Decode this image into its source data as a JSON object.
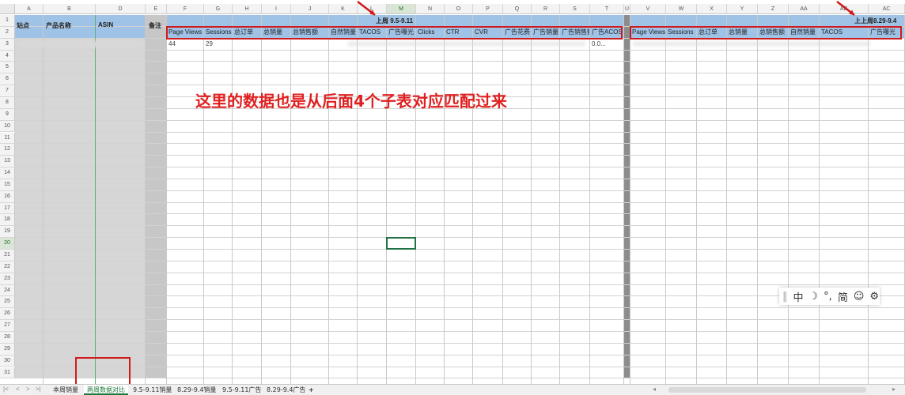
{
  "columns": [
    "A",
    "B",
    "D",
    "E",
    "F",
    "G",
    "H",
    "I",
    "J",
    "K",
    "L",
    "M",
    "N",
    "O",
    "P",
    "Q",
    "R",
    "S",
    "T",
    "U",
    "V",
    "W",
    "X",
    "Y",
    "Z",
    "AA",
    "AB",
    "AC"
  ],
  "rows": [
    "1",
    "2",
    "3",
    "4",
    "5",
    "6",
    "7",
    "8",
    "9",
    "10",
    "11",
    "12",
    "13",
    "14",
    "15",
    "16",
    "17",
    "18",
    "19",
    "20",
    "21",
    "22",
    "23",
    "24",
    "25",
    "26",
    "27",
    "28",
    "29",
    "30",
    "31"
  ],
  "left_headers": {
    "site": "站点",
    "product": "产品名称",
    "asin": "ASIN",
    "note": "备注"
  },
  "week1": {
    "title": "上周 9.5-9.11",
    "headers": [
      "Page Views",
      "Sessions",
      "总订单",
      "总销量",
      "总销售额",
      "自然销量",
      "TACOS",
      "广告曝光",
      "Clicks",
      "CTR",
      "CVR",
      "广告花费",
      "广告销量",
      "广告销售额",
      "广告ACOS"
    ],
    "row3": [
      "44",
      "29",
      "",
      "",
      "",
      "",
      "",
      "",
      "",
      "",
      "",
      "",
      "",
      "",
      "0.0..."
    ]
  },
  "week2": {
    "title": "上上周8.29-9.4",
    "headers": [
      "Page Views",
      "Sessions",
      "总订单",
      "总销量",
      "总销售额",
      "自然销量",
      "TACOS",
      "广告曝光"
    ]
  },
  "annotation": "这里的数据也是从后面4个子表对应匹配过来",
  "ime": {
    "items": [
      "中",
      "☽",
      "°,",
      "简",
      "☺",
      "⚙"
    ]
  },
  "sheet_tabs": [
    "本周销量",
    "两周数据对比",
    "9.5-9.11销量",
    "8.29-9.4销量",
    "9.5-9.11广告",
    "8.29-9.4广告"
  ],
  "active_tab": "两周数据对比",
  "add_tab": "+",
  "selected_cell": "M20",
  "colors": {
    "header_blue": "#9fc3e7",
    "annotation_red": "#e02020",
    "selection_green": "#217346"
  }
}
